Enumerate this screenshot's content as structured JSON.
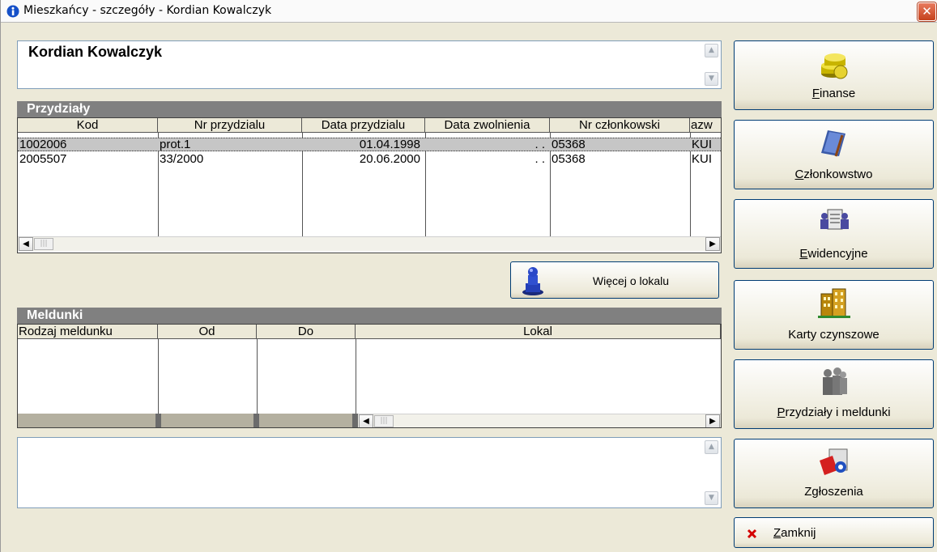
{
  "window": {
    "title": "Mieszkańcy - szczegóły - Kordian Kowalczyk",
    "close_glyph": "✕"
  },
  "resident": {
    "name": "Kordian Kowalczyk"
  },
  "przydzialy": {
    "title": "Przydziały",
    "columns": [
      "Kod",
      "Nr przydzialu",
      "Data przydzialu",
      "Data zwolnienia",
      "Nr członkowski",
      "azw"
    ],
    "rows": [
      {
        "kod": "1002006",
        "nr": "prot.1",
        "data_przydzialu": "01.04.1998",
        "data_zwolnienia": ". .",
        "nr_czlonkowski": "05368",
        "azw": "KUI"
      },
      {
        "kod": "2005507",
        "nr": "33/2000",
        "data_przydzialu": "20.06.2000",
        "data_zwolnienia": ". .",
        "nr_czlonkowski": "05368",
        "azw": "KUI"
      }
    ],
    "selected_row": 0
  },
  "wiecej_button": {
    "label": "Więcej o lokalu",
    "icon": "person-pedestal-icon"
  },
  "meldunki": {
    "title": "Meldunki",
    "columns": [
      "Rodzaj meldunku",
      "Od",
      "Do",
      "Lokal"
    ]
  },
  "side_buttons": [
    {
      "first": "F",
      "rest": "inanse",
      "icon": "coins-icon"
    },
    {
      "first": "C",
      "rest": "złonkowstwo",
      "icon": "notebook-icon"
    },
    {
      "first": "E",
      "rest": "widencyjne",
      "icon": "clipboard-people-icon"
    },
    {
      "first": "",
      "rest": "Karty czynszowe",
      "icon": "building-icon"
    },
    {
      "first": "P",
      "rest": "rzydziały i meldunki",
      "icon": "people-group-icon"
    },
    {
      "first": "",
      "rest": "Zgłoszenia",
      "icon": "reports-icon"
    }
  ],
  "close_button": {
    "first": "Z",
    "rest": "amknij",
    "icon": "red-x-icon"
  },
  "scroll_glyphs": {
    "up": "▲",
    "down": "▼",
    "left": "◀",
    "right": "▶",
    "grip": "|||"
  },
  "colors": {
    "section_bar": "#808080",
    "selected_row": "#c6c6c6",
    "button_border": "#003c74",
    "close_red": "#d40000"
  }
}
